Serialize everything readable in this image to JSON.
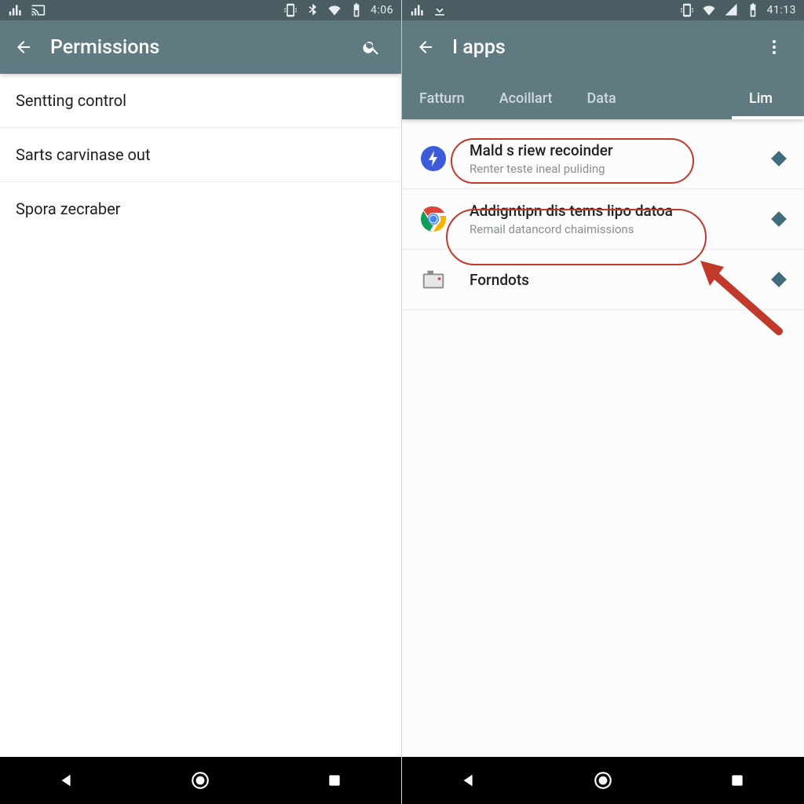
{
  "left": {
    "status": {
      "time": "4:06"
    },
    "appbar": {
      "title": "Permissions"
    },
    "rows": [
      {
        "label": "Sentting control"
      },
      {
        "label": "Sarts carvinase out"
      },
      {
        "label": "Spora zecraber"
      }
    ]
  },
  "right": {
    "status": {
      "time": "41:13"
    },
    "appbar": {
      "title": "I apps"
    },
    "tabs": [
      {
        "label": "Fatturn"
      },
      {
        "label": "Acoillart"
      },
      {
        "label": "Data"
      },
      {
        "label": "Lim"
      }
    ],
    "active_tab_index": 3,
    "apps": [
      {
        "title": "Mald s riew recoinder",
        "sub": "Renter teste ineal puliding",
        "icon": "bolt"
      },
      {
        "title": "Addigntipn dis tems lipo datoa",
        "sub": "Remail datancord chaimissions",
        "icon": "chrome"
      },
      {
        "title": "Forndots",
        "sub": "",
        "icon": "camera"
      }
    ]
  },
  "colors": {
    "header": "#5f7a80",
    "statusbar": "#4a5d62",
    "accent": "#3e6c7a",
    "annotation": "#c0392b"
  }
}
